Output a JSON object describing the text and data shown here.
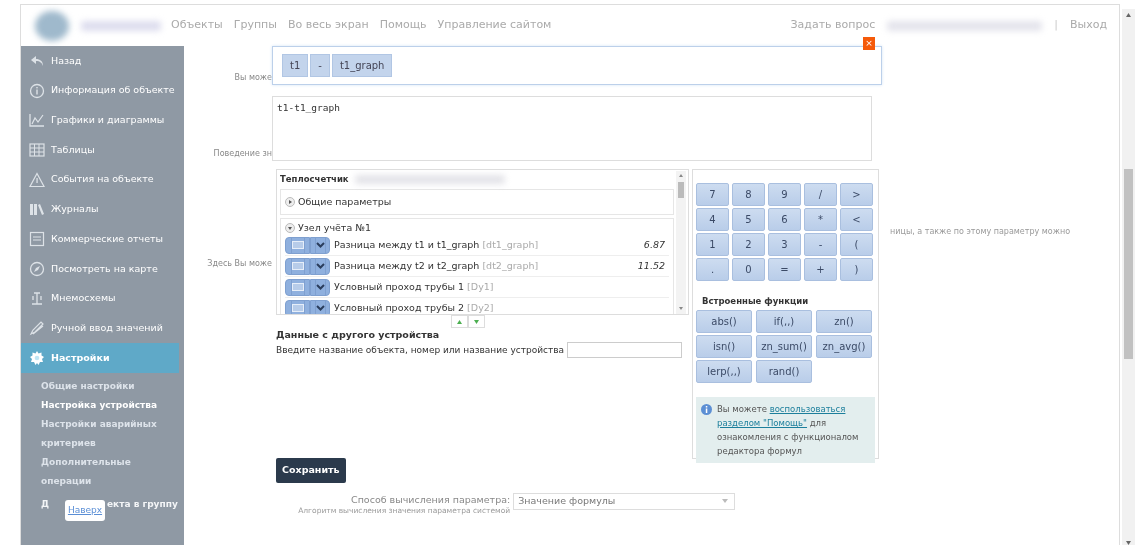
{
  "header": {
    "nav": [
      "Объекты",
      "Группы",
      "Во весь экран",
      "Помощь",
      "Управление сайтом"
    ],
    "ask": "Задать вопрос",
    "separator": "|",
    "logout": "Выход",
    "close": "×"
  },
  "sidebar": {
    "items": [
      {
        "label": "Назад",
        "selected": false
      },
      {
        "label": "Информация об объекте",
        "selected": false
      },
      {
        "label": "Графики и диаграммы",
        "selected": false
      },
      {
        "label": "Таблицы",
        "selected": false
      },
      {
        "label": "События на объекте",
        "selected": false
      },
      {
        "label": "Журналы",
        "selected": false
      },
      {
        "label": "Коммерческие отчеты",
        "selected": false
      },
      {
        "label": "Посмотреть на карте",
        "selected": false
      },
      {
        "label": "Мнемосхемы",
        "selected": false
      },
      {
        "label": "Ручной ввод значений",
        "selected": false
      },
      {
        "label": "Настройки",
        "selected": true
      }
    ],
    "subitems": [
      {
        "label": "Общие настройки",
        "selected": false
      },
      {
        "label": "Настройка устройства",
        "selected": true
      },
      {
        "label": "Настройки аварийных критериев",
        "selected": false
      },
      {
        "label": "Дополнительные операции",
        "selected": false
      }
    ],
    "last_subitem": {
      "start": "Д",
      "end": "екта в группу"
    },
    "to_top": "Наверх"
  },
  "form_labels": [
    "Вы може",
    "Поведение зн",
    "Здесь Вы може"
  ],
  "right_text": "ницы, а также по этому параметру можно",
  "formula": {
    "tokens": [
      "t1",
      "-",
      "t1_graph"
    ],
    "text": "t1-t1_graph"
  },
  "params": {
    "device": "Теплосчетчик",
    "groups": [
      {
        "label": "Общие параметры",
        "expanded": false
      },
      {
        "label": "Узел учёта №1",
        "expanded": true,
        "rows": [
          {
            "name": "Разница между t1 и t1_graph",
            "code": "[dt1_graph]",
            "value": "6.87"
          },
          {
            "name": "Разница между t2 и t2_graph",
            "code": "[dt2_graph]",
            "value": "11.52"
          },
          {
            "name": "Условный проход трубы 1",
            "code": "[Dy1]"
          },
          {
            "name": "Условный проход трубы 2",
            "code": "[Dy2]"
          }
        ]
      }
    ]
  },
  "other_device": {
    "title": "Данные с другого устройства",
    "prompt": "Введите название объекта, номер или название устройства"
  },
  "keypad": [
    "7",
    "8",
    "9",
    "/",
    ">",
    "4",
    "5",
    "6",
    "*",
    "<",
    "1",
    "2",
    "3",
    "-",
    "(",
    ".",
    "0",
    "=",
    "+",
    ")"
  ],
  "functions_title": "Встроенные функции",
  "functions": [
    "abs()",
    "if(,,)",
    "zn()",
    "isn()",
    "zn_sum()",
    "zn_avg()",
    "lerp(,,)",
    "rand()"
  ],
  "info": {
    "before": "Вы можете",
    "link_lines": [
      "воспользоваться",
      "разделом \"Помощь\""
    ],
    "after": "для ознакомления с функционалом редактора формул"
  },
  "save": "Сохранить",
  "method": {
    "label": "Способ вычисления параметра:",
    "value": "Значение формулы",
    "hint": "Алгоритм вычисления значения параметра системой"
  }
}
